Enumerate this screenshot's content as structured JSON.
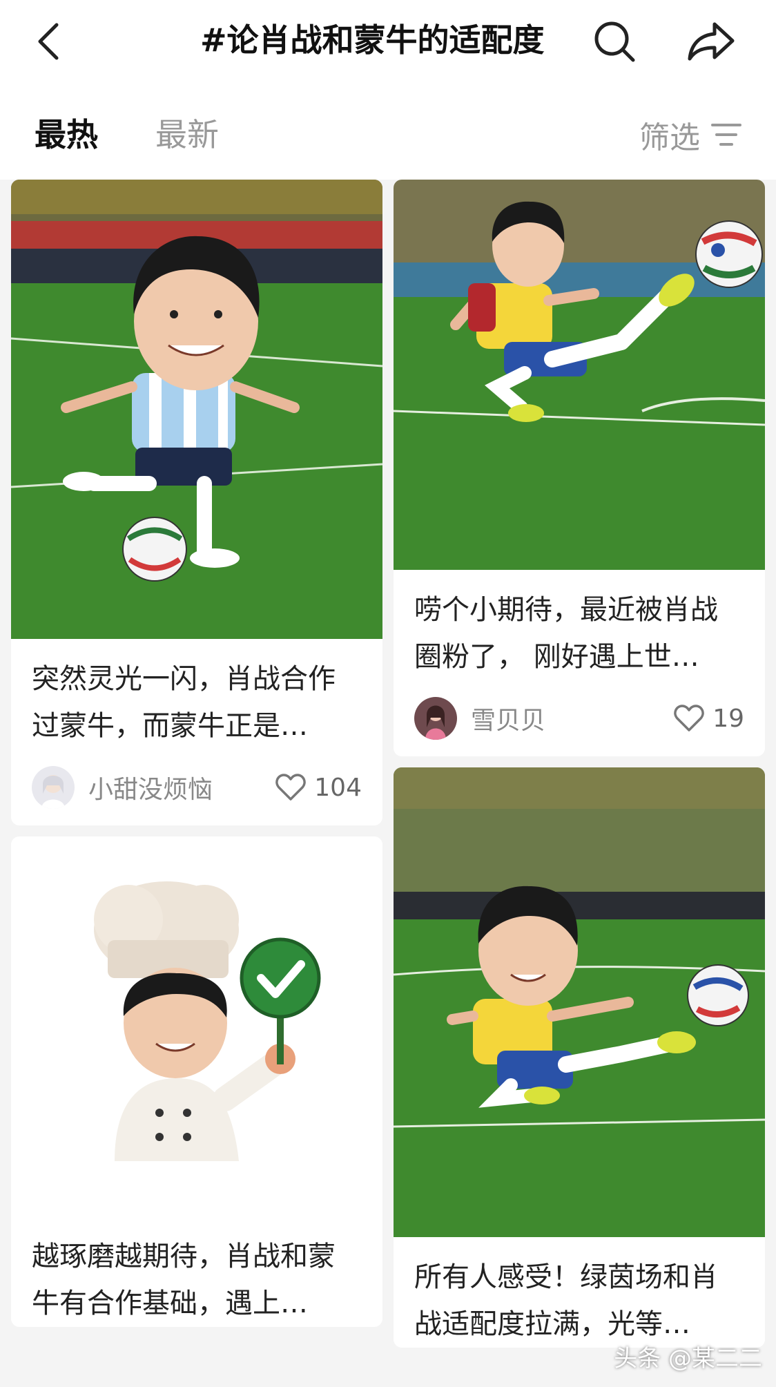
{
  "header": {
    "title": "#论肖战和蒙牛的适配度",
    "back_icon": "chevron-left-icon",
    "search_icon": "search-icon",
    "share_icon": "share-arrow-icon"
  },
  "tabs": {
    "hot": "最热",
    "new": "最新",
    "filter": "筛选",
    "filter_icon": "filter-lines-icon"
  },
  "colors": {
    "accent_text": "#111111",
    "muted_text": "#999999",
    "feed_bg": "#f4f4f4",
    "grass": "#3f8a2e"
  },
  "cards": {
    "c1": {
      "title": "突然灵光一闪，肖战合作过蒙牛，而蒙牛正是…",
      "author": "小甜没烦恼",
      "likes": "104",
      "image": "argentina-jersey-football-player-illustration"
    },
    "c2": {
      "title": "唠个小期待，最近被肖战圈粉了， 刚好遇上世…",
      "author": "雪贝贝",
      "likes": "19",
      "image": "brazil-jersey-kicking-player-illustration"
    },
    "c3": {
      "title": "越琢磨越期待，肖战和蒙牛有合作基础，遇上…",
      "image": "chef-hat-thumbs-sign-illustration"
    },
    "c4": {
      "title": "所有人感受！绿茵场和肖战适配度拉满，光等…",
      "image": "brazil-jersey-volley-player-illustration"
    }
  },
  "watermark": "头条 @某二二"
}
